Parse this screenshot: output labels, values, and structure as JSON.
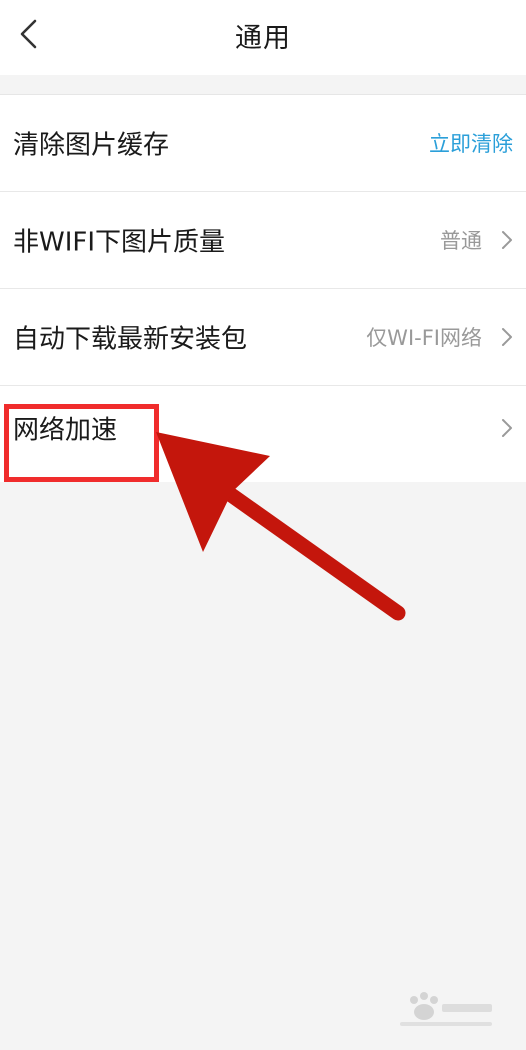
{
  "header": {
    "title": "通用",
    "back_icon": "chevron-left-icon"
  },
  "settings": [
    {
      "label": "清除图片缓存",
      "action": "立即清除"
    },
    {
      "label": "非WIFI下图片质量",
      "value": "普通"
    },
    {
      "label": "自动下载最新安装包",
      "value": "仅WI-FI网络"
    },
    {
      "label": "网络加速",
      "value": ""
    }
  ],
  "colors": {
    "action": "#2b9fd9",
    "annotation": "#f02c2c",
    "arrow": "#c4160c",
    "background": "#f4f4f4"
  },
  "annotation": {
    "highlight": "highlight-box",
    "arrow": "arrow-pointer"
  }
}
